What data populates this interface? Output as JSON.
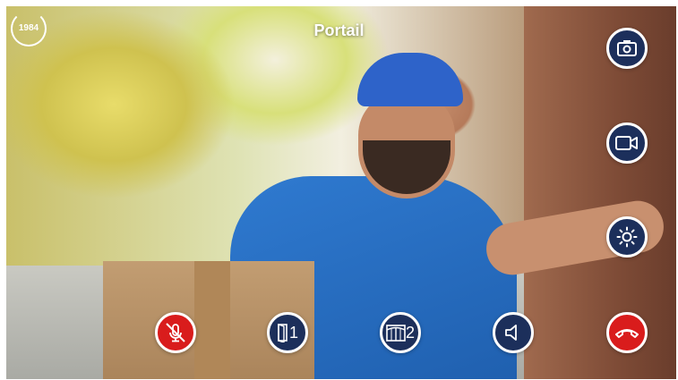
{
  "screen": {
    "title": "Portail",
    "logo_text": "1984"
  },
  "controls": {
    "right": [
      {
        "name": "snapshot-button",
        "icon": "camera-photo-icon"
      },
      {
        "name": "record-button",
        "icon": "video-camera-icon"
      },
      {
        "name": "brightness-button",
        "icon": "sun-icon"
      }
    ],
    "bottom": [
      {
        "name": "mute-microphone-button",
        "icon": "microphone-off-icon"
      },
      {
        "name": "open-door-1-button",
        "icon": "door-icon",
        "label": "1"
      },
      {
        "name": "open-gate-2-button",
        "icon": "gate-icon",
        "label": "2"
      },
      {
        "name": "volume-button",
        "icon": "speaker-icon"
      },
      {
        "name": "hang-up-button",
        "icon": "phone-hangup-icon"
      }
    ]
  },
  "colors": {
    "button_navy": "#1c2f5b",
    "button_red": "#d91c1c",
    "button_border": "#ffffff"
  }
}
